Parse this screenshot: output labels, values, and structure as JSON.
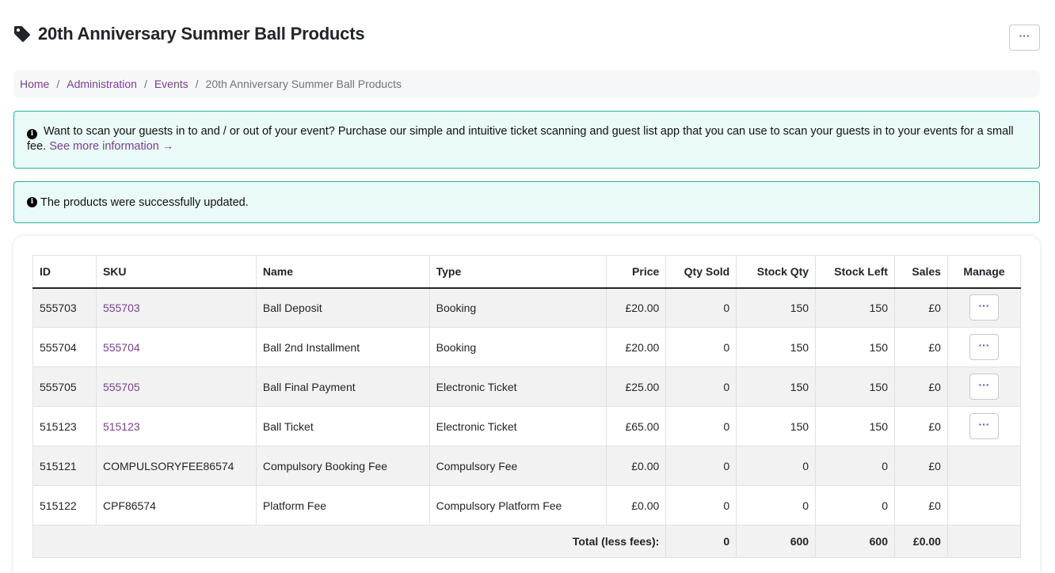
{
  "header": {
    "title": "20th Anniversary Summer Ball Products",
    "menu_label": "···"
  },
  "breadcrumb": {
    "items": [
      "Home",
      "Administration",
      "Events"
    ],
    "separator": "/",
    "current": "20th Anniversary Summer Ball Products"
  },
  "alerts": {
    "scan": {
      "text": "Want to scan your guests in to and / or out of your event? Purchase our simple and intuitive ticket scanning and guest list app that you can use to scan your guests in to your events for a small fee.",
      "link": "See more information →"
    },
    "success": {
      "text": "The products were successfully updated."
    }
  },
  "table": {
    "headers": [
      "ID",
      "SKU",
      "Name",
      "Type",
      "Price",
      "Qty Sold",
      "Stock Qty",
      "Stock Left",
      "Sales",
      "Manage"
    ],
    "rows": [
      {
        "id": "555703",
        "sku": "555703",
        "name": "Ball Deposit",
        "type": "Booking",
        "price": "£20.00",
        "qty_sold": "0",
        "stock_qty": "150",
        "stock_left": "150",
        "sales": "£0",
        "manage": "···"
      },
      {
        "id": "555704",
        "sku": "555704",
        "name": "Ball 2nd Installment",
        "type": "Booking",
        "price": "£20.00",
        "qty_sold": "0",
        "stock_qty": "150",
        "stock_left": "150",
        "sales": "£0",
        "manage": "···"
      },
      {
        "id": "555705",
        "sku": "555705",
        "name": "Ball Final Payment",
        "type": "Electronic Ticket",
        "price": "£25.00",
        "qty_sold": "0",
        "stock_qty": "150",
        "stock_left": "150",
        "sales": "£0",
        "manage": "···"
      },
      {
        "id": "515123",
        "sku": "515123",
        "name": "Ball Ticket",
        "type": "Electronic Ticket",
        "price": "£65.00",
        "qty_sold": "0",
        "stock_qty": "150",
        "stock_left": "150",
        "sales": "£0",
        "manage": "···"
      },
      {
        "id": "515121",
        "sku": "COMPULSORYFEE86574",
        "name": "Compulsory Booking Fee",
        "type": "Compulsory Fee",
        "price": "£0.00",
        "qty_sold": "0",
        "stock_qty": "0",
        "stock_left": "0",
        "sales": "£0"
      },
      {
        "id": "515122",
        "sku": "CPF86574",
        "name": "Platform Fee",
        "type": "Compulsory Platform Fee",
        "price": "£0.00",
        "qty_sold": "0",
        "stock_qty": "0",
        "stock_left": "0",
        "sales": "£0"
      }
    ],
    "footer": {
      "label": "Total (less fees):",
      "qty_sold": "0",
      "stock_qty": "600",
      "stock_left": "600",
      "sales": "£0.00"
    }
  },
  "colors": {
    "link": "#7a3f8c",
    "alert_bg": "#eafaf8",
    "alert_border": "#2ab3a3",
    "stripe": "#f2f2f2"
  }
}
